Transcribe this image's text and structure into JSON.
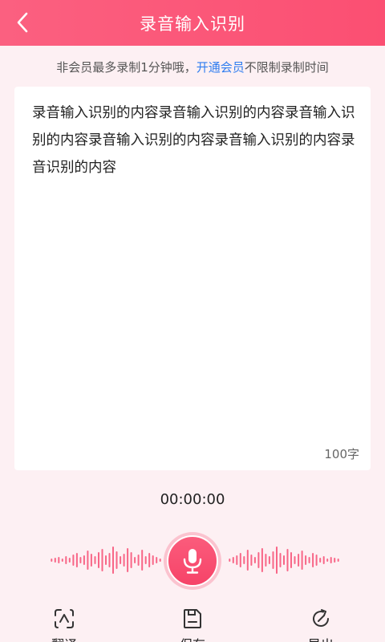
{
  "header": {
    "title": "录音输入识别",
    "back_icon": "chevron-left-icon"
  },
  "notice": {
    "prefix": "非会员最多录制1分钟哦，",
    "link": "开通会员",
    "suffix": "不限制录制时间"
  },
  "transcript": {
    "text": "录音输入识别的内容录音输入识别的内容录音输入识别的内容录音输入识别的内容录音输入识别的内容录音识别的内容",
    "count": "100字"
  },
  "recorder": {
    "timer": "00:00:00",
    "mic_icon": "microphone-icon"
  },
  "toolbar": {
    "translate": "翻译",
    "save": "保存",
    "export": "导出"
  },
  "colors": {
    "accent": "#fb5275",
    "background": "#fdf0f3",
    "link": "#2f7df0"
  }
}
